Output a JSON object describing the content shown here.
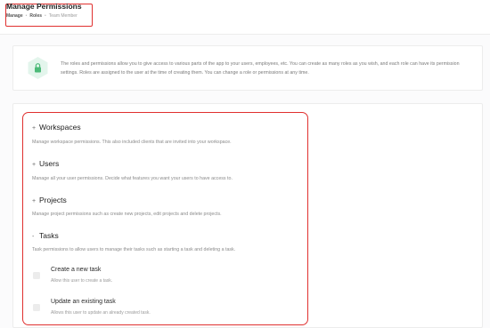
{
  "header": {
    "title": "Manage Permissions",
    "breadcrumb": [
      "Manage",
      "Roles",
      "Team Member"
    ],
    "breadcrumb_separator": "•"
  },
  "info": {
    "icon": "lock-icon",
    "text": "The roles and permissions allow you to give access to various parts of the app to your users, employees, etc. You can create as many roles as you wish, and each role can have its permission settings. Roles are assigned to the user at the time of creating them. You can change a role or permissions at any time."
  },
  "permissions": {
    "sections": [
      {
        "toggle": "+",
        "title": "Workspaces",
        "description": "Manage workspace permissions. This also included clients that are invited into your workspace."
      },
      {
        "toggle": "+",
        "title": "Users",
        "description": "Manage all your user permissions. Decide what features you want your users to have access to."
      },
      {
        "toggle": "+",
        "title": "Projects",
        "description": "Manage project permissions such as create new projects, edit projects and delete projects."
      },
      {
        "toggle": "-",
        "title": "Tasks",
        "description": "Task permissions to allow users to manage their tasks such as starting a task and deleting a task."
      }
    ],
    "task_items": [
      {
        "label": "Create a new task",
        "description": "Allow this user to create a task.",
        "checked": false
      },
      {
        "label": "Update an existing task",
        "description": "Allows this user to update an already created task.",
        "checked": false
      }
    ]
  },
  "colors": {
    "highlight": "#e0302f",
    "shield_bg": "#e3f5ec",
    "shield_icon": "#4cba78"
  }
}
